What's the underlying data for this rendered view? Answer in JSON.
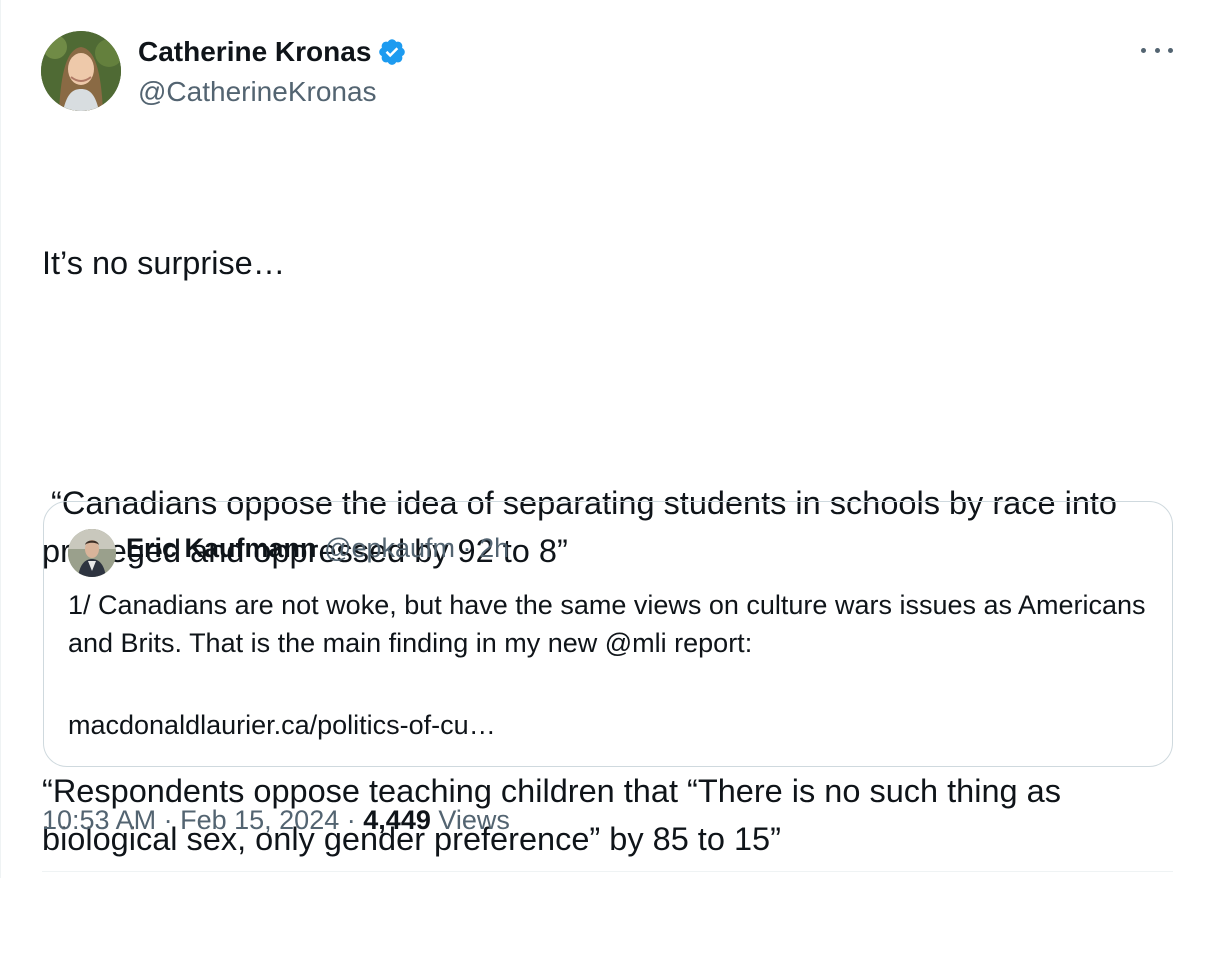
{
  "author": {
    "name": "Catherine Kronas",
    "handle": "@CatherineKronas",
    "verified": true
  },
  "tweet": {
    "text": [
      "It’s no surprise…",
      "",
      " “Canadians oppose the idea of separating students in schools by race into privileged and oppressed by 92 to 8”",
      "",
      "“Respondents oppose teaching children that “There is no such thing as biological sex, only gender preference” by 85 to 15”"
    ]
  },
  "quote": {
    "name": "Eric Kaufmann",
    "handle": "@epkaufm",
    "separator": "·",
    "time": "2h",
    "text": [
      "1/ Canadians are not woke, but have the same views on culture wars issues as Americans and Brits. That is the main finding in my new @mli report:"
    ],
    "link": "macdonaldlaurier.ca/politics-of-cu…"
  },
  "meta": {
    "time": "10:53 AM",
    "separator": "·",
    "date": "Feb 15, 2024",
    "views_count": "4,449",
    "views_label": "Views"
  },
  "icons": {
    "verified": "verified-badge-icon",
    "more": "more-options-icon"
  },
  "colors": {
    "text": "#0f1419",
    "secondary": "#536471",
    "verified": "#1d9bf0",
    "border": "#cfd9de"
  }
}
